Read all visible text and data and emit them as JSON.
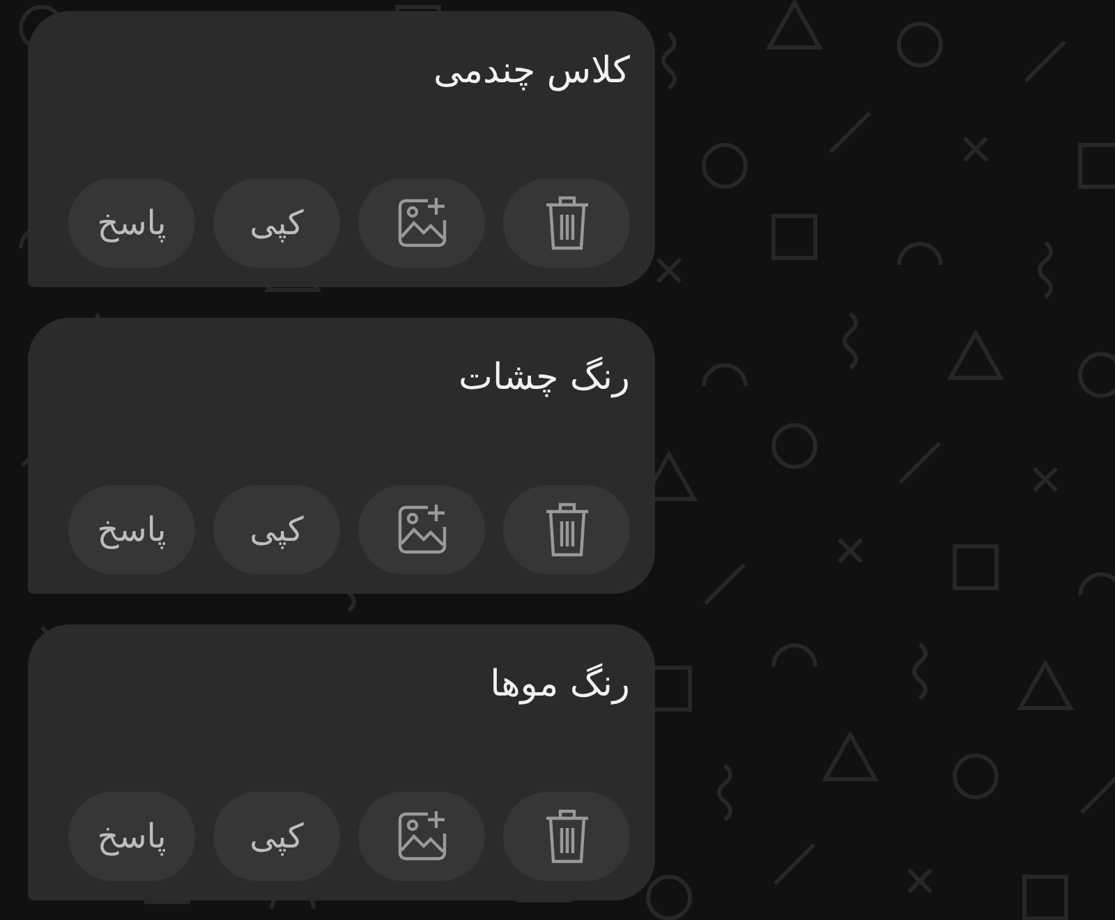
{
  "messages": [
    {
      "text": "کلاس چندمی",
      "actions": [
        {
          "kind": "delete"
        },
        {
          "kind": "add-image"
        },
        {
          "kind": "text",
          "label": "کپی"
        },
        {
          "kind": "text",
          "label": "پاسخ"
        }
      ]
    },
    {
      "text": "رنگ چشات",
      "actions": [
        {
          "kind": "delete"
        },
        {
          "kind": "add-image"
        },
        {
          "kind": "text",
          "label": "کپی"
        },
        {
          "kind": "text",
          "label": "پاسخ"
        }
      ]
    },
    {
      "text": "رنگ موها",
      "actions": [
        {
          "kind": "delete"
        },
        {
          "kind": "add-image"
        },
        {
          "kind": "text",
          "label": "کپی"
        },
        {
          "kind": "text",
          "label": "پاسخ"
        }
      ]
    }
  ]
}
